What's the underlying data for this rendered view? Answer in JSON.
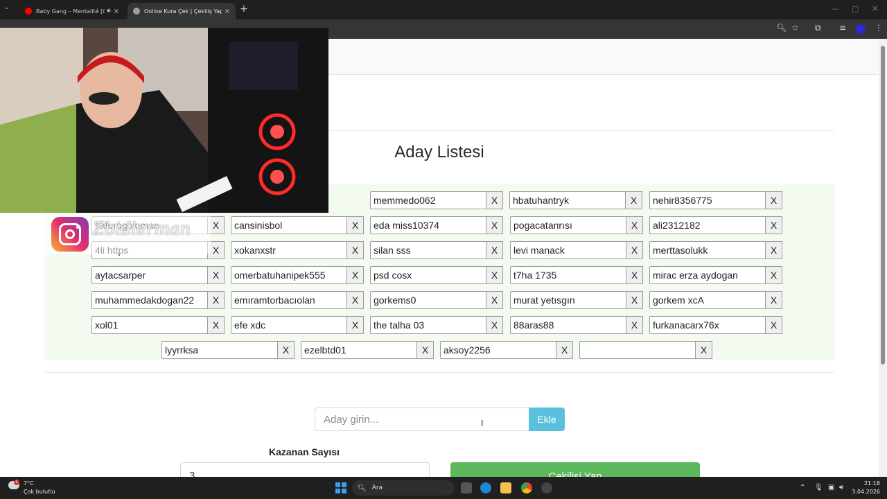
{
  "browser": {
    "tabs": [
      {
        "title": "Baby Gang – Mentalité [Offi…",
        "favicon_color": "#ff0000",
        "muted_icon": "speaker-icon"
      },
      {
        "title": "Online Kura Çek | Çekiliş Yap",
        "favicon_color": "#9aa0a6"
      }
    ],
    "new_tab": "+",
    "close": "×"
  },
  "page": {
    "heading": "Aday Listesi",
    "remove_label": "X",
    "candidates": [
      "memmedo062",
      "hbatuhantryk",
      "nehir8356775",
      "saturogojoman",
      "cansinisbol",
      "eda miss10374",
      "pogacatanrısı",
      "ali2312182",
      "4li https",
      "xokanxstr",
      "silan sss",
      "levi manack",
      "merttasolukk",
      "aytacsarper",
      "omerbatuhanipek555",
      "psd cosx",
      "t7ha 1735",
      "mirac erza aydogan",
      "muhammedakdogan22",
      "emıramtorbacıolan",
      "gorkems0",
      "murat yetısgın",
      "gorkem xcA",
      "xol01",
      "efe xdc",
      "the talha 03",
      "88aras88",
      "furkanacarx76x",
      "lyyrrksa",
      "ezelbtd01",
      "aksoy2256"
    ],
    "add_input_placeholder": "Aday girin...",
    "add_button": "Ekle",
    "winners_label": "Kazanan Sayısı",
    "winners_value": "3",
    "draw_button": "Çekilişi Yap"
  },
  "overlay": {
    "instagram_handle": "Zbidlerman"
  },
  "taskbar": {
    "weather_temp": "7°C",
    "weather_desc": "Çok bulutlu",
    "weather_badge": "1",
    "search_label": "Ara",
    "time": "21:18",
    "date": "3.04.2026"
  }
}
